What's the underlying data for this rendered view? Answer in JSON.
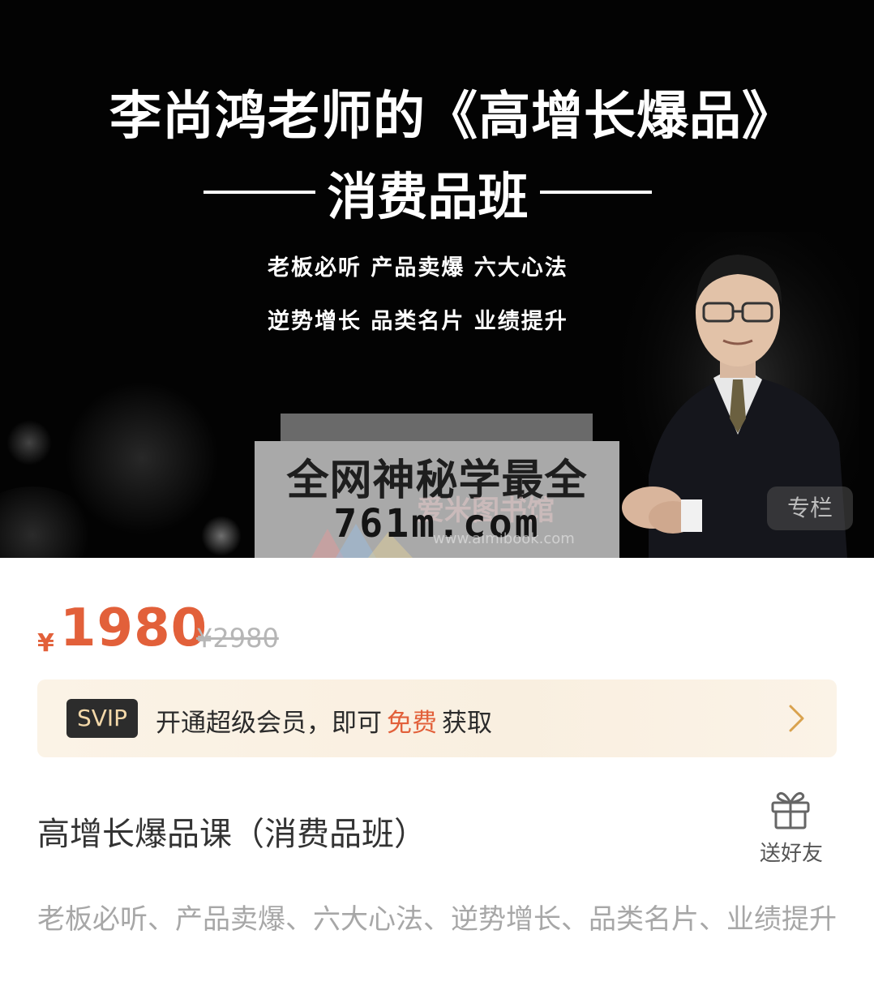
{
  "banner": {
    "title": "李尚鸿老师的《高增长爆品》",
    "subtitle": "消费品班",
    "line1": "老板必听  产品卖爆  六大心法",
    "line2": "逆势增长  品类名片  业绩提升",
    "badge": "专栏"
  },
  "watermark": {
    "line1": "全网神秘学最全",
    "line2": "761m.com",
    "faint_text": "爱米图书馆",
    "url": "www.aimibook.com"
  },
  "price": {
    "symbol": "¥",
    "value": "1980",
    "original": "¥2980",
    "color": "#e2603a"
  },
  "vip": {
    "tag": "SVIP",
    "text_before": "开通超级会员，即可",
    "text_free": "免费",
    "text_after": "获取",
    "icon": "chevron-right-icon"
  },
  "course": {
    "title": "高增长爆品课（消费品班）",
    "gift_label": "送好友",
    "gift_icon": "gift-icon",
    "description": "老板必听、产品卖爆、六大心法、逆势增长、品类名片、业绩提升"
  }
}
